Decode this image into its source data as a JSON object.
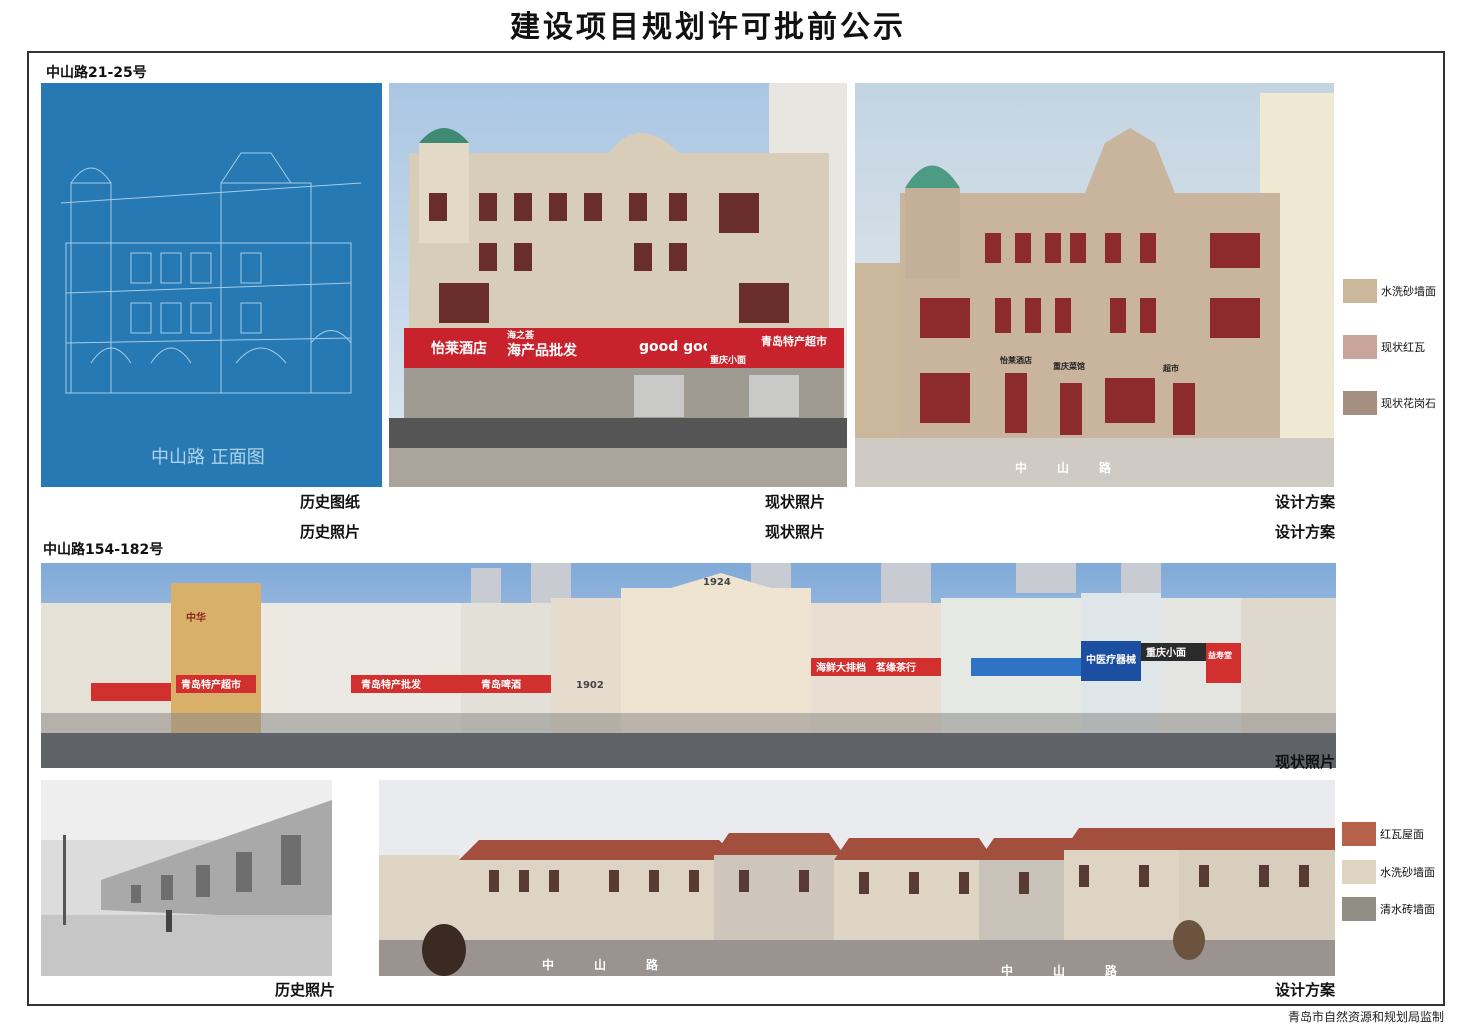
{
  "header": {
    "title": "建设项目规划许可批前公示"
  },
  "section1": {
    "label": "中山路21-25号",
    "captions": {
      "blueprint": "历史图纸",
      "history_photo": "历史照片",
      "current_photo_a": "现状照片",
      "current_photo_b": "现状照片",
      "design_a": "设计方案",
      "design_b": "设计方案"
    },
    "blueprint_text": "中山路 正面图",
    "current_signs": {
      "hotel": "怡莱酒店",
      "seafood_top": "海之荟",
      "seafood": "海产品批发",
      "goods": "good goods",
      "noodles": "重庆小面",
      "specialty": "青岛特产超市"
    },
    "design_signs": {
      "hotel": "怡莱酒店",
      "noodles": "重庆菜馆",
      "market": "超市",
      "road": "中山路"
    },
    "legend": [
      {
        "label": "水洗砂墙面",
        "color": "#cbb79c"
      },
      {
        "label": "现状红瓦",
        "color": "#c9a49a"
      },
      {
        "label": "现状花岗石",
        "color": "#a48e80"
      }
    ]
  },
  "section2": {
    "label": "中山路154-182号",
    "captions": {
      "current_photo": "现状照片",
      "history_photo": "历史照片",
      "design": "设计方案"
    },
    "street_signs": [
      "中华",
      "青岛特产超市",
      "青岛特产批发",
      "青岛啤酒",
      "1902",
      "1924",
      "海鲜大排档",
      "茗缘茶行",
      "中医疗器械",
      "重庆小面",
      "益寿堂"
    ],
    "design_road": "中山路",
    "legend": [
      {
        "label": "红瓦屋面",
        "color": "#b5614c"
      },
      {
        "label": "水洗砂墙面",
        "color": "#ddd4c4"
      },
      {
        "label": "清水砖墙面",
        "color": "#8f8f86"
      }
    ]
  },
  "footer": {
    "text": "青岛市自然资源和规划局监制"
  }
}
